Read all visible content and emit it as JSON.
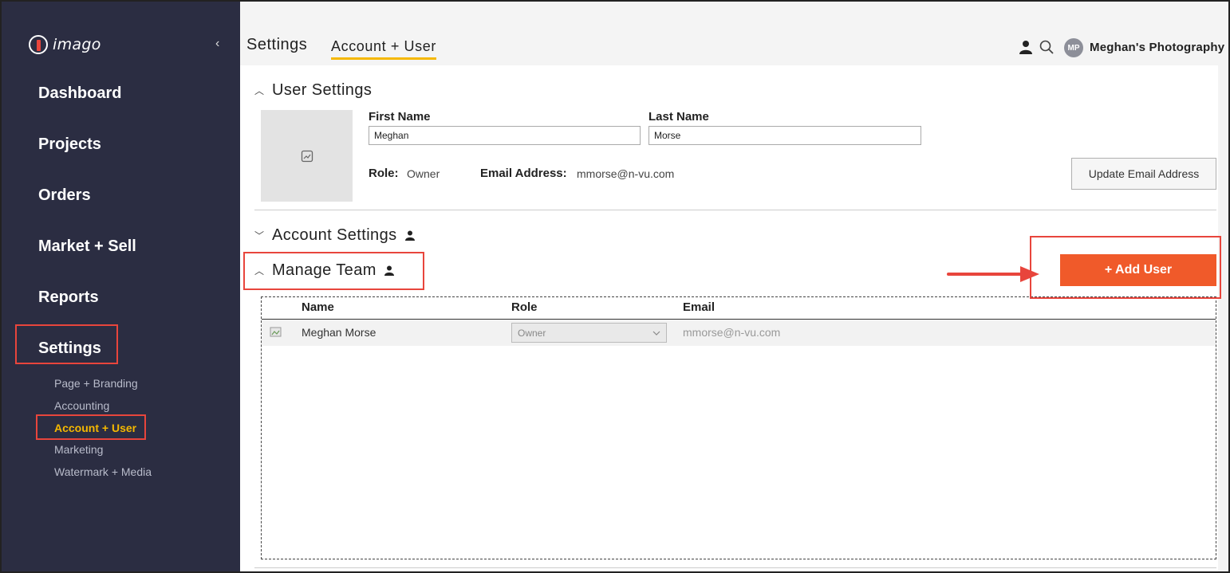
{
  "sidebar": {
    "logo_text": "imago",
    "collapse_glyph": "‹",
    "nav": [
      {
        "label": "Dashboard"
      },
      {
        "label": "Projects"
      },
      {
        "label": "Orders"
      },
      {
        "label": "Market + Sell"
      },
      {
        "label": "Reports"
      },
      {
        "label": "Settings"
      }
    ],
    "settings_sub": [
      {
        "label": "Page + Branding"
      },
      {
        "label": "Accounting"
      },
      {
        "label": "Account + User"
      },
      {
        "label": "Marketing"
      },
      {
        "label": "Watermark + Media"
      }
    ]
  },
  "header": {
    "title": "Settings",
    "active_tab": "Account + User",
    "avatar_initials": "MP",
    "account_name": "Meghan's Photography"
  },
  "user_settings": {
    "title": "User Settings",
    "first_name_label": "First Name",
    "first_name_value": "Meghan",
    "last_name_label": "Last Name",
    "last_name_value": "Morse",
    "role_label": "Role:",
    "role_value": "Owner",
    "email_label": "Email Address:",
    "email_value": "mmorse@n-vu.com",
    "update_email_button": "Update Email Address"
  },
  "account_settings": {
    "title": "Account Settings"
  },
  "manage_team": {
    "title": "Manage Team",
    "add_user_button": "+ Add User",
    "columns": [
      "Name",
      "Role",
      "Email"
    ],
    "rows": [
      {
        "name": "Meghan Morse",
        "role": "Owner",
        "email": "mmorse@n-vu.com"
      }
    ]
  },
  "colors": {
    "sidebar_bg": "#2b2d42",
    "accent_yellow": "#f5b800",
    "add_user_orange": "#f05a2a",
    "highlight_red": "#e8453c"
  },
  "icons": [
    "chevron-left-icon",
    "user-icon",
    "search-icon",
    "image-placeholder-icon",
    "chevron-up-icon",
    "chevron-down-icon",
    "person-icon",
    "broken-image-icon",
    "arrow-right-icon"
  ]
}
